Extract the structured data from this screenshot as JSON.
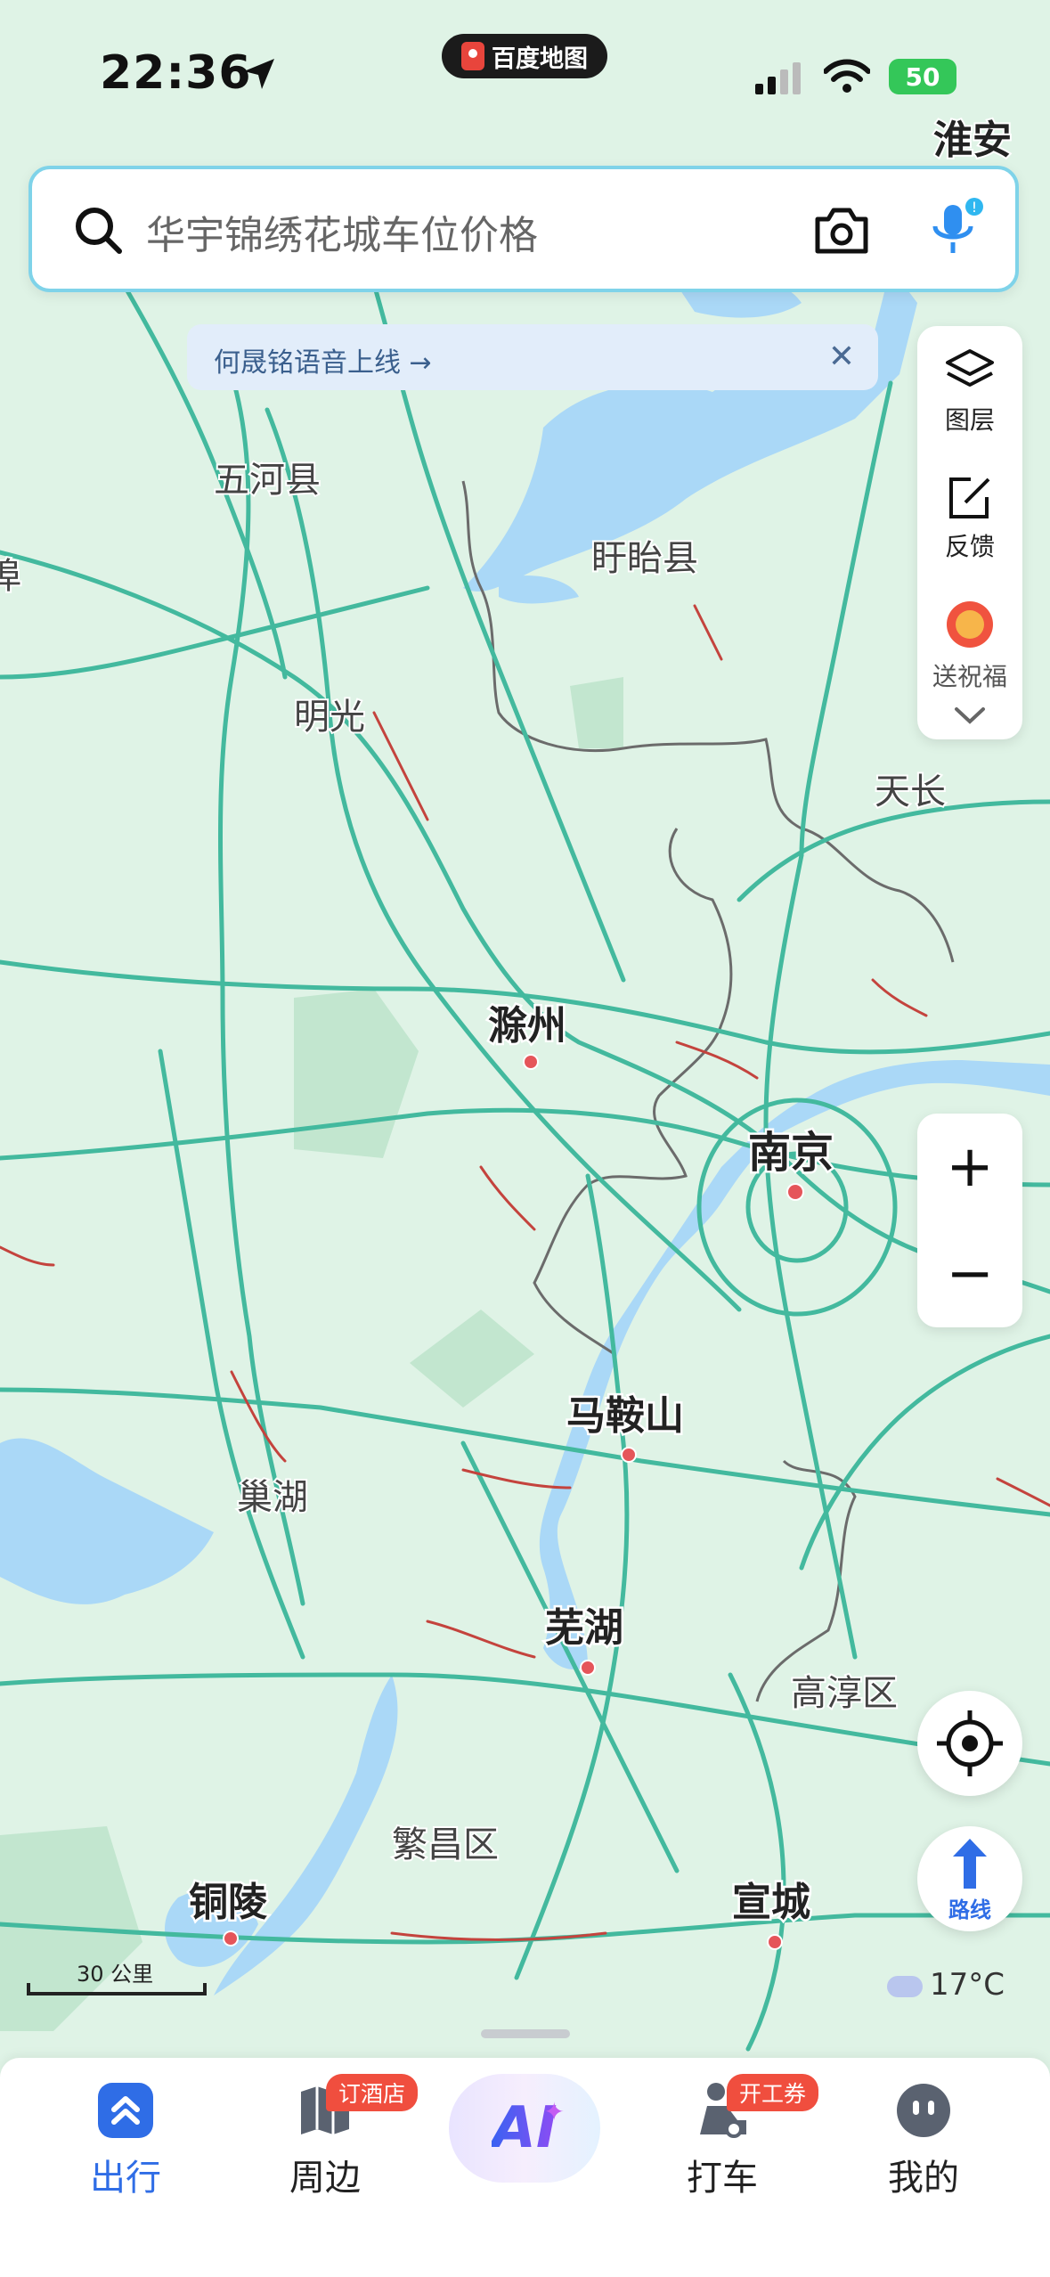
{
  "status_bar": {
    "time": "22:36",
    "battery": "50",
    "app_name": "百度地图"
  },
  "search": {
    "placeholder": "华宇锦绣花城车位价格"
  },
  "tip": {
    "text": "何晟铭语音上线 →",
    "close": "✕"
  },
  "side_panel": {
    "layers": "图层",
    "feedback": "反馈",
    "blessing": "送祝福"
  },
  "zoom": {
    "in": "+",
    "out": "−"
  },
  "route": {
    "label": "路线"
  },
  "weather": {
    "temperature": "17°C"
  },
  "scale": {
    "label": "30 公里"
  },
  "map_labels": {
    "huaian": "淮安",
    "wuhe": "五河县",
    "edge_left": "埠",
    "xuyi": "盱眙县",
    "mingguang": "明光",
    "tianchang": "天长",
    "chuzhou": "滁州",
    "nanjing": "南京",
    "maanshan": "马鞍山",
    "chaohu": "巢湖",
    "wuhu": "芜湖",
    "gaochun": "高淳区",
    "fanchang": "繁昌区",
    "tongling": "铜陵",
    "xuancheng": "宣城"
  },
  "tabbar": {
    "travel": "出行",
    "nearby": "周边",
    "nearby_badge": "订酒店",
    "ai": "AI",
    "taxi": "打车",
    "taxi_badge": "开工券",
    "mine": "我的"
  },
  "colors": {
    "accent": "#2f6de6",
    "road": "#43b99e",
    "water": "#aad8f7",
    "border": "#6b6b6b"
  }
}
